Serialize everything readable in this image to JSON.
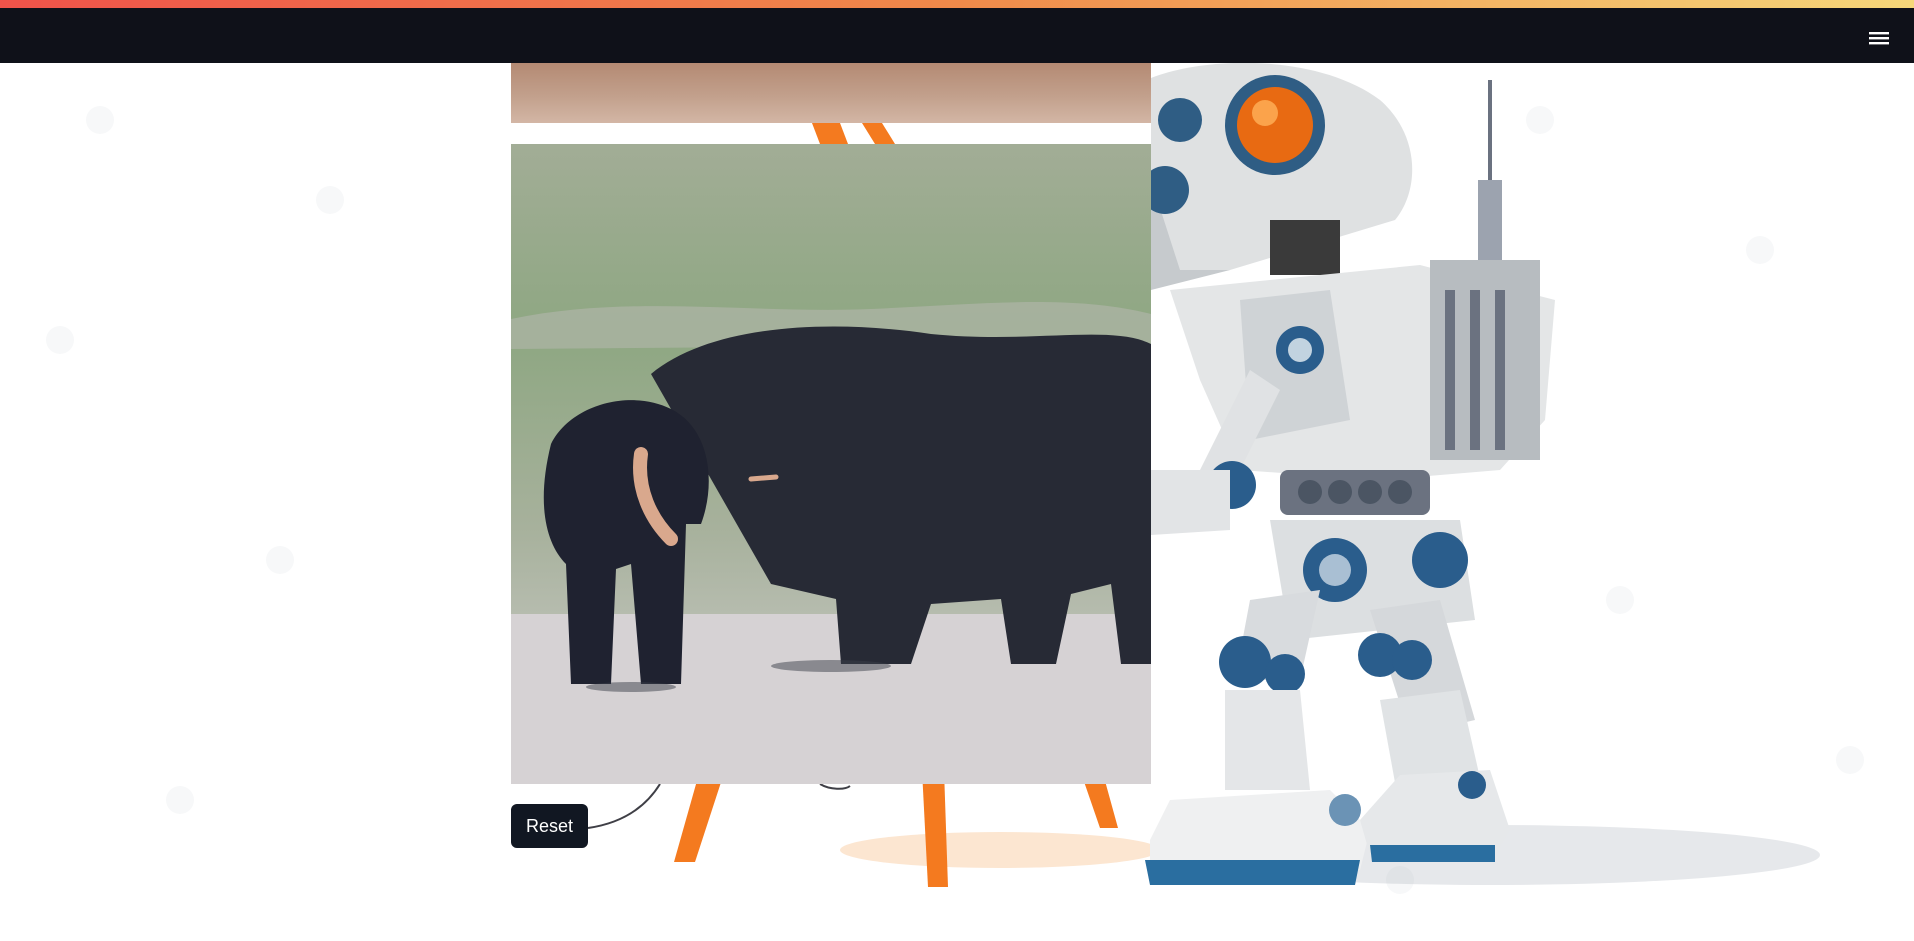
{
  "header": {
    "menu_icon": "hamburger-menu-icon",
    "stripe_colors": [
      "#f0534a",
      "#f08a4a",
      "#f6d77a"
    ],
    "background": "#0f1119"
  },
  "main": {
    "reset_button_label": "Reset"
  },
  "images": {
    "top_photo": "partial-photo-brown-ground",
    "main_photo": "elephant-photo",
    "background_art": "robot-painting-at-easel"
  }
}
